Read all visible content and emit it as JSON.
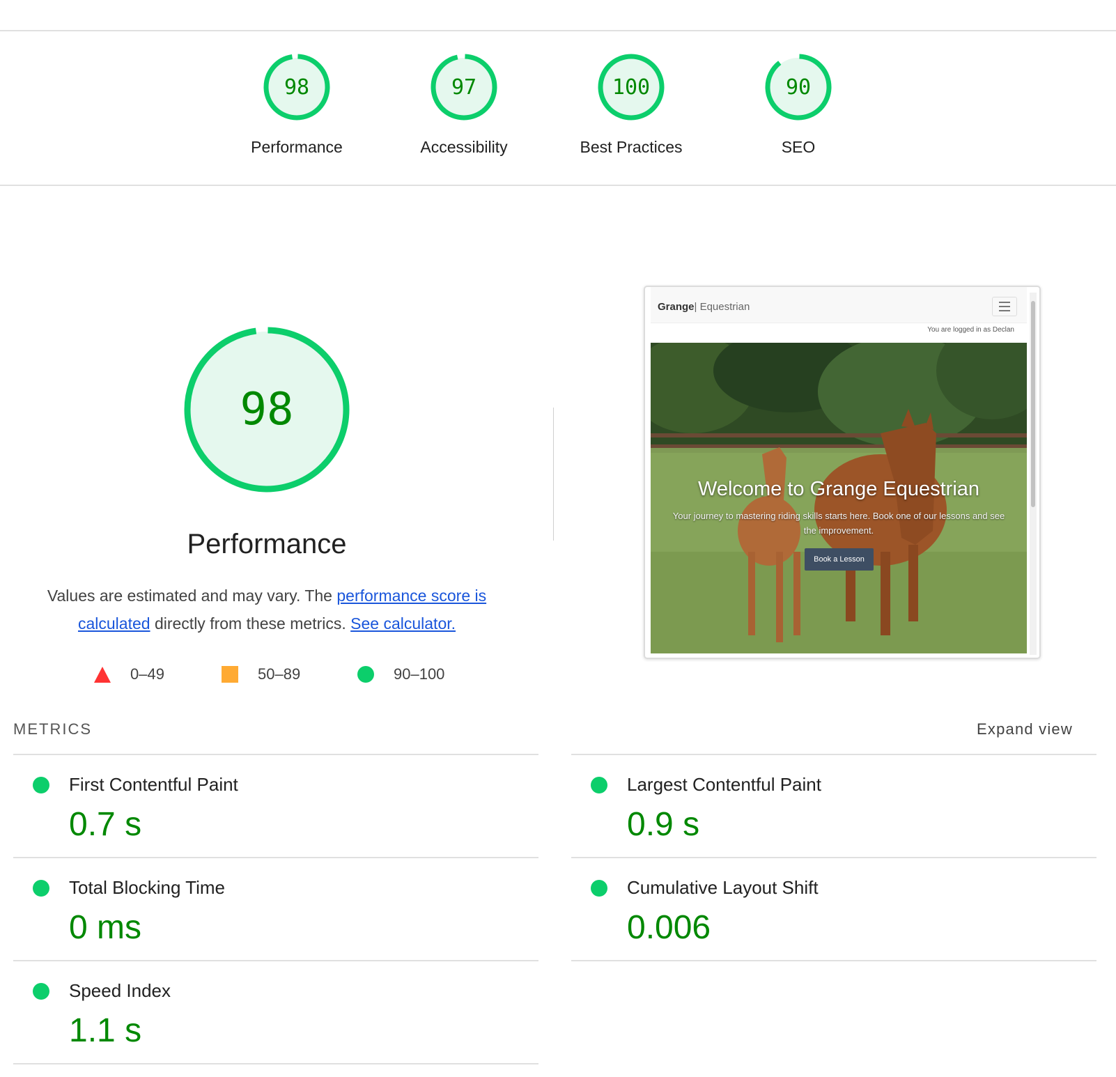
{
  "summary": {
    "categories": [
      {
        "score": "98",
        "label": "Performance",
        "fraction": 0.98
      },
      {
        "score": "97",
        "label": "Accessibility",
        "fraction": 0.97
      },
      {
        "score": "100",
        "label": "Best Practices",
        "fraction": 1.0
      },
      {
        "score": "90",
        "label": "SEO",
        "fraction": 0.9
      }
    ]
  },
  "performance": {
    "score": "98",
    "fraction": 0.98,
    "title": "Performance",
    "description_prefix": "Values are estimated and may vary. The ",
    "score_link": "performance score is calculated",
    "description_middle": " directly from these metrics. ",
    "calculator_link": "See calculator."
  },
  "legend": [
    {
      "shape": "triangle",
      "range": "0–49",
      "color": "#ff3333"
    },
    {
      "shape": "square",
      "range": "50–89",
      "color": "#ffaa33"
    },
    {
      "shape": "circle",
      "range": "90–100",
      "color": "#0cce6b"
    }
  ],
  "screenshot": {
    "brand_name": "Grange",
    "brand_separator": "|",
    "brand_sub": " Equestrian",
    "logged_in_text": "You are logged in as Declan",
    "hero_title": "Welcome to Grange Equestrian",
    "hero_subtitle": "Your journey to mastering riding skills starts here. Book one of our lessons and see the improvement.",
    "hero_button": "Book a Lesson",
    "menu_icon": "hamburger-menu-icon"
  },
  "metrics": {
    "heading": "METRICS",
    "expand_label": "Expand view",
    "items": [
      {
        "title": "First Contentful Paint",
        "value": "0.7 s"
      },
      {
        "title": "Largest Contentful Paint",
        "value": "0.9 s"
      },
      {
        "title": "Total Blocking Time",
        "value": "0 ms"
      },
      {
        "title": "Cumulative Layout Shift",
        "value": "0.006"
      },
      {
        "title": "Speed Index",
        "value": "1.1 s"
      }
    ]
  },
  "colors": {
    "pass_green": "#0cce6b",
    "pass_text": "#008800",
    "gauge_fill": "#e5f8ee",
    "link": "#1a56db"
  }
}
